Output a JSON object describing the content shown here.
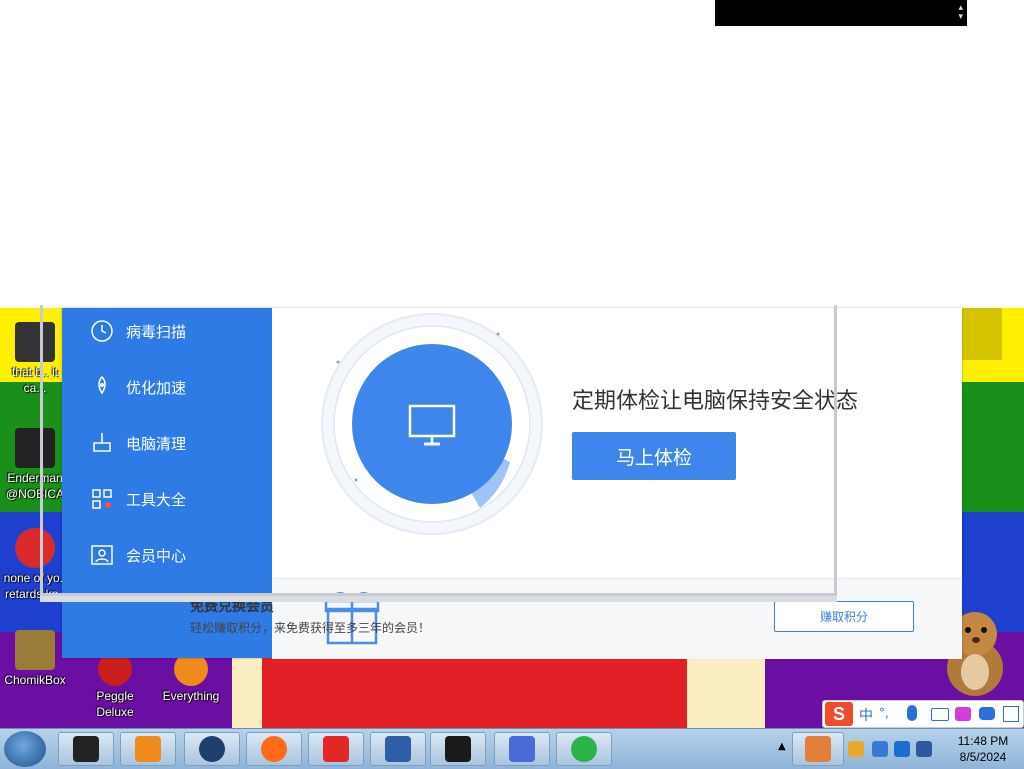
{
  "sidebar": {
    "items": [
      {
        "label": "病毒扫描",
        "icon": "scan-icon"
      },
      {
        "label": "优化加速",
        "icon": "rocket-icon"
      },
      {
        "label": "电脑清理",
        "icon": "broom-icon"
      },
      {
        "label": "工具大全",
        "icon": "apps-icon"
      },
      {
        "label": "会员中心",
        "icon": "user-icon"
      }
    ]
  },
  "main": {
    "headline": "定期体检让电脑保持安全状态",
    "check_button": "马上体检",
    "monitor_icon": "monitor-icon"
  },
  "reward": {
    "title": "免费兑换会员",
    "subtitle": "轻松赚取积分，来免费获得至多三年的会员！",
    "earn_button": "赚取积分",
    "gift_icon": "gift-icon"
  },
  "desktop": {
    "icons": [
      {
        "label": "that b.. it ca..."
      },
      {
        "label": "Enderman @NOBICA"
      },
      {
        "label": "none of yo.. retards kn.."
      },
      {
        "label": "ChomikBox"
      },
      {
        "label": "Peggle Deluxe"
      },
      {
        "label": "Everything"
      }
    ]
  },
  "ime": {
    "logo": "S",
    "mode": "中"
  },
  "clock": {
    "time": "11:48 PM",
    "date": "8/5/2024"
  },
  "colors": {
    "sidebar": "#2e7be6",
    "accent": "#3f86ec",
    "taskbar": "#a9c4df"
  }
}
